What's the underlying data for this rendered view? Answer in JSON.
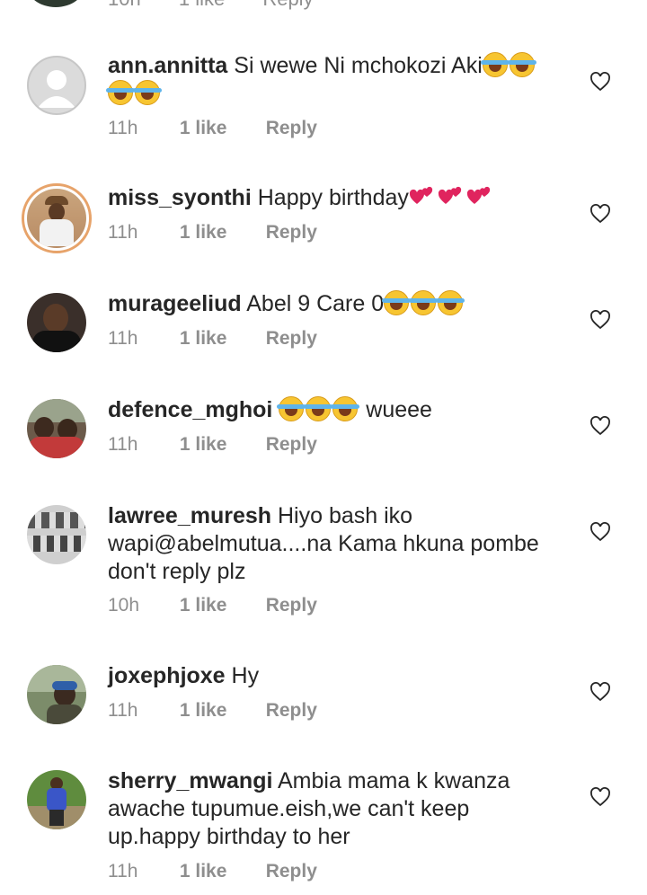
{
  "top_partial": {
    "time": "10h",
    "likes": "1 like",
    "reply": "Reply"
  },
  "comments": [
    {
      "username": "ann.annitta",
      "text": "Si wewe Ni mchokozi Aki",
      "emoji": "😂😂😂😂",
      "time": "11h",
      "likes": "1 like",
      "reply": "Reply"
    },
    {
      "username": "miss_syonthi",
      "text": "Happy birthday",
      "emoji": "💕💕💕",
      "time": "11h",
      "likes": "1 like",
      "reply": "Reply"
    },
    {
      "username": "murageeliud",
      "text": "Abel 9 Care 0",
      "emoji": "😂😂😂",
      "time": "11h",
      "likes": "1 like",
      "reply": "Reply"
    },
    {
      "username": "defence_mghoi",
      "text": "wueee",
      "emoji": "😂😂😂",
      "time": "11h",
      "likes": "1 like",
      "reply": "Reply"
    },
    {
      "username": "lawree_muresh",
      "text": "Hiyo bash iko wapi@abelmutua....na Kama hkuna pombe don't reply plz",
      "time": "10h",
      "likes": "1 like",
      "reply": "Reply"
    },
    {
      "username": "joxephjoxe",
      "text": "Hy",
      "time": "11h",
      "likes": "1 like",
      "reply": "Reply"
    },
    {
      "username": "sherry_mwangi",
      "text": "Ambia mama k kwanza awache tupumue.eish,we can't keep up.happy birthday to her",
      "time": "11h",
      "likes": "1 like",
      "reply": "Reply"
    }
  ],
  "icons": {
    "like": "heart-outline-icon",
    "avatar_placeholder": "default-avatar-icon"
  },
  "colors": {
    "text": "#262626",
    "meta": "#8e8e8e",
    "story_ring": "#e7a36a"
  }
}
